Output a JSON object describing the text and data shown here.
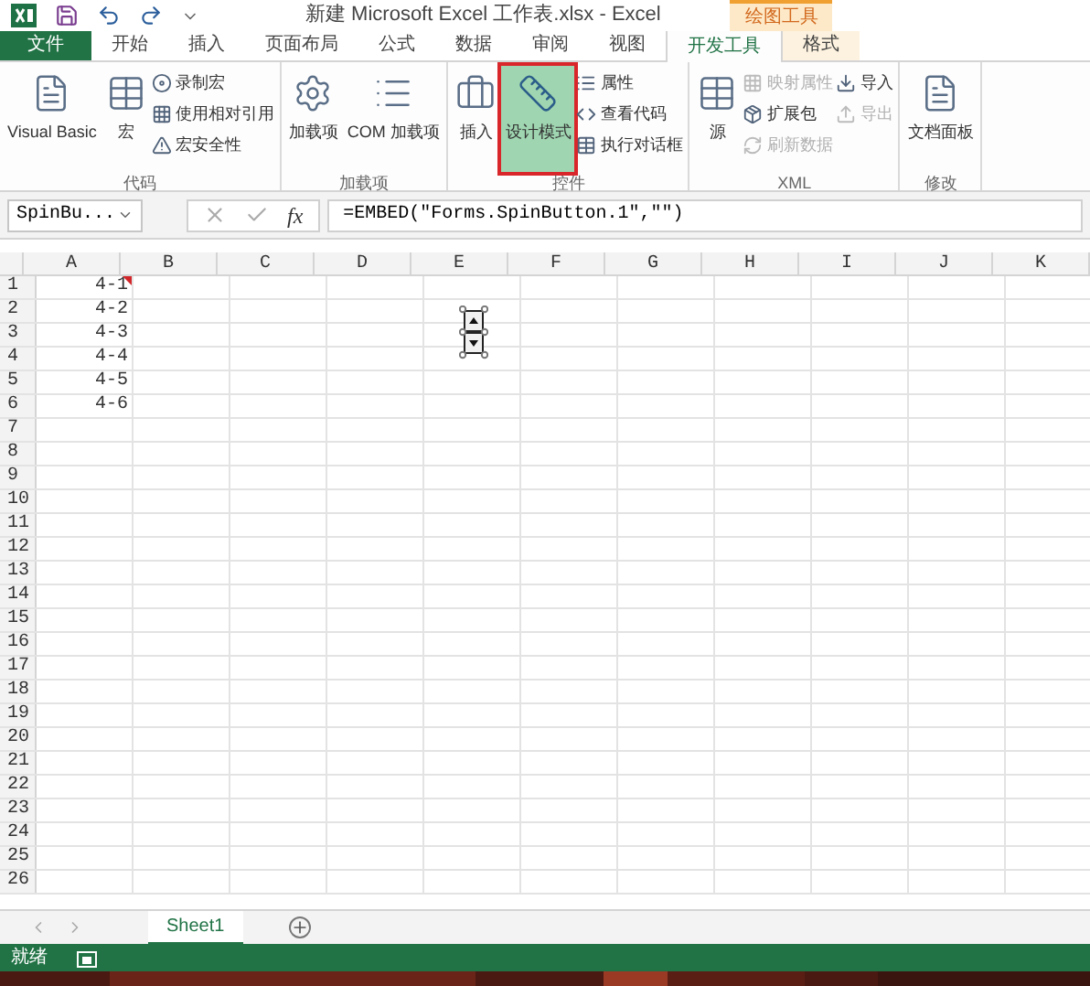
{
  "title_bar": {
    "title": "新建 Microsoft Excel 工作表.xlsx - Excel",
    "context_tab": "绘图工具"
  },
  "tabs": [
    {
      "label": "文件",
      "kind": "file",
      "selected": false
    },
    {
      "label": "开始",
      "kind": "tab",
      "selected": false
    },
    {
      "label": "插入",
      "kind": "tab",
      "selected": false
    },
    {
      "label": "页面布局",
      "kind": "tab",
      "selected": false
    },
    {
      "label": "公式",
      "kind": "tab",
      "selected": false
    },
    {
      "label": "数据",
      "kind": "tab",
      "selected": false
    },
    {
      "label": "审阅",
      "kind": "tab",
      "selected": false
    },
    {
      "label": "视图",
      "kind": "tab",
      "selected": false
    },
    {
      "label": "开发工具",
      "kind": "tab",
      "selected": true
    },
    {
      "label": "格式",
      "kind": "context",
      "selected": false
    }
  ],
  "ribbon": {
    "groups": [
      {
        "label": "代码",
        "controls": [
          {
            "kind": "large",
            "label": "Visual Basic",
            "disabled": false,
            "on": false
          },
          {
            "kind": "large",
            "label": "宏",
            "disabled": false,
            "on": false
          },
          {
            "kind": "small",
            "label": "录制宏",
            "disabled": false,
            "on": false
          },
          {
            "kind": "small",
            "label": "使用相对引用",
            "disabled": false,
            "on": false
          },
          {
            "kind": "small",
            "label": "宏安全性",
            "disabled": false,
            "on": false
          }
        ]
      },
      {
        "label": "加载项",
        "controls": [
          {
            "kind": "large",
            "label": "加载项",
            "disabled": false,
            "on": false
          },
          {
            "kind": "large",
            "label": "COM 加载项",
            "disabled": false,
            "on": false
          }
        ]
      },
      {
        "label": "控件",
        "controls": [
          {
            "kind": "large",
            "label": "插入",
            "disabled": false,
            "on": false
          },
          {
            "kind": "large",
            "label": "设计模式",
            "disabled": false,
            "on": true
          },
          {
            "kind": "small",
            "label": "属性",
            "disabled": false,
            "on": false
          },
          {
            "kind": "small",
            "label": "查看代码",
            "disabled": false,
            "on": false
          },
          {
            "kind": "small",
            "label": "执行对话框",
            "disabled": false,
            "on": false
          }
        ]
      },
      {
        "label": "XML",
        "controls": [
          {
            "kind": "large",
            "label": "源",
            "disabled": false,
            "on": false
          },
          {
            "kind": "small",
            "label": "映射属性",
            "disabled": true,
            "on": false
          },
          {
            "kind": "small",
            "label": "扩展包",
            "disabled": false,
            "on": false
          },
          {
            "kind": "small",
            "label": "刷新数据",
            "disabled": true,
            "on": false
          },
          {
            "kind": "small",
            "label": "导入",
            "disabled": false,
            "on": false
          },
          {
            "kind": "small",
            "label": "导出",
            "disabled": true,
            "on": false
          }
        ]
      },
      {
        "label": "修改",
        "controls": [
          {
            "kind": "large",
            "label": "文档面板",
            "disabled": false,
            "on": false
          }
        ]
      }
    ]
  },
  "formula_bar": {
    "name_box": "SpinBu...",
    "function_label": "fx",
    "formula": "=EMBED(\"Forms.SpinButton.1\",\"\")"
  },
  "sheet": {
    "columns": [
      "A",
      "B",
      "C",
      "D",
      "E",
      "F",
      "G",
      "H",
      "I",
      "J",
      "K"
    ],
    "rows": [
      {
        "label": "1",
        "cells": [
          {
            "text": "4-1",
            "comment": true
          }
        ]
      },
      {
        "label": "2",
        "cells": [
          {
            "text": "4-2",
            "comment": false
          }
        ]
      },
      {
        "label": "3",
        "cells": [
          {
            "text": "4-3",
            "comment": false
          }
        ]
      },
      {
        "label": "4",
        "cells": [
          {
            "text": "4-4",
            "comment": false
          }
        ]
      },
      {
        "label": "5",
        "cells": [
          {
            "text": "4-5",
            "comment": false
          }
        ]
      },
      {
        "label": "6",
        "cells": [
          {
            "text": "4-6",
            "comment": false
          }
        ]
      },
      {
        "label": "7"
      },
      {
        "label": "8"
      },
      {
        "label": "9"
      },
      {
        "label": "10"
      },
      {
        "label": "11"
      },
      {
        "label": "12"
      },
      {
        "label": "13"
      },
      {
        "label": "14"
      },
      {
        "label": "15"
      },
      {
        "label": "16"
      },
      {
        "label": "17"
      },
      {
        "label": "18"
      },
      {
        "label": "19"
      },
      {
        "label": "20"
      },
      {
        "label": "21"
      },
      {
        "label": "22"
      },
      {
        "label": "23"
      },
      {
        "label": "24"
      },
      {
        "label": "25"
      },
      {
        "label": "26"
      }
    ],
    "spin_button": {
      "selected": true
    }
  },
  "sheet_tabs": [
    {
      "label": "Sheet1",
      "selected": true
    }
  ],
  "status_bar": {
    "text": "就绪"
  }
}
